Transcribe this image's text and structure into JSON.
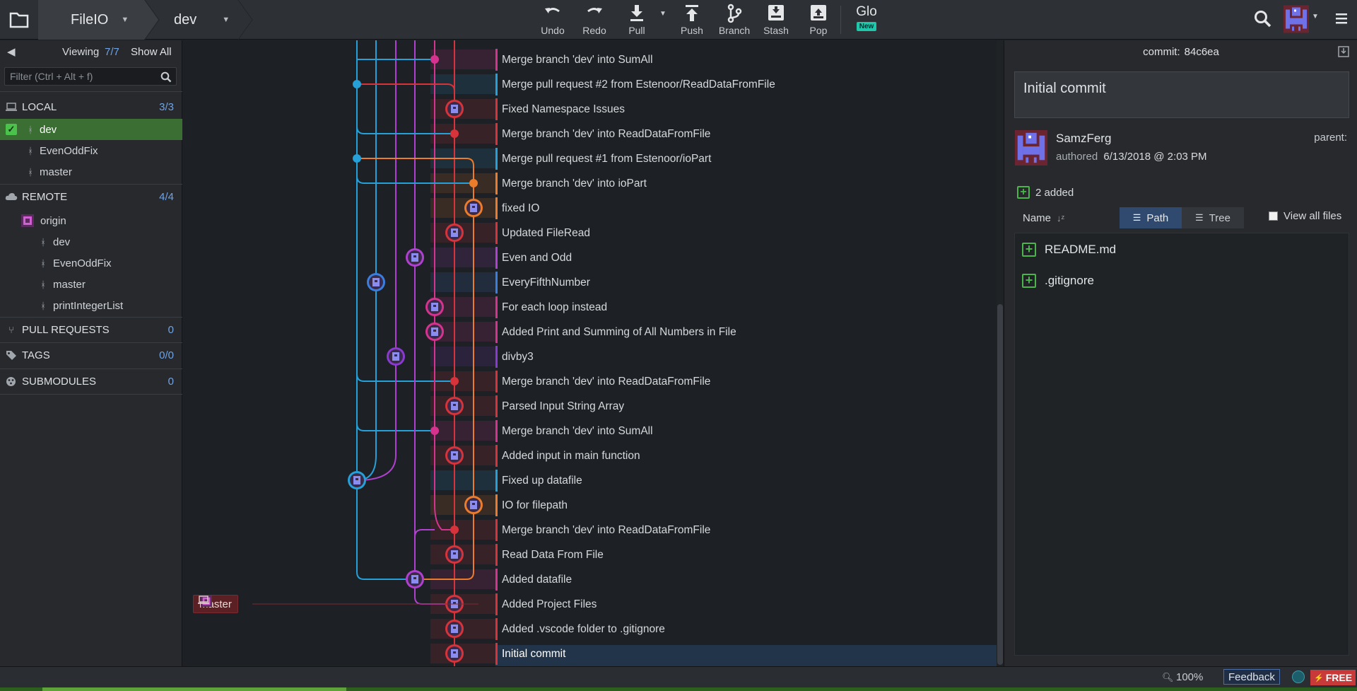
{
  "toolbar": {
    "repo": "FileIO",
    "branch": "dev",
    "buttons": [
      {
        "label": "Undo",
        "icon": "undo-icon"
      },
      {
        "label": "Redo",
        "icon": "redo-icon"
      },
      {
        "label": "Pull",
        "icon": "pull-icon"
      },
      {
        "label": "Push",
        "icon": "push-icon"
      },
      {
        "label": "Branch",
        "icon": "branch-icon"
      },
      {
        "label": "Stash",
        "icon": "stash-icon"
      },
      {
        "label": "Pop",
        "icon": "pop-icon"
      }
    ],
    "glo": "Glo",
    "glo_badge": "New"
  },
  "left": {
    "viewing_label": "Viewing",
    "viewing_count": "7/7",
    "show_all": "Show All",
    "filter_placeholder": "Filter (Ctrl + Alt + f)",
    "local": {
      "label": "LOCAL",
      "count": "3/3",
      "branches": [
        "dev",
        "EvenOddFix",
        "master"
      ]
    },
    "remote": {
      "label": "REMOTE",
      "count": "4/4",
      "origin": "origin",
      "branches": [
        "dev",
        "EvenOddFix",
        "master",
        "printIntegerList"
      ]
    },
    "pull_requests": {
      "label": "PULL REQUESTS",
      "count": "0"
    },
    "tags": {
      "label": "TAGS",
      "count": "0/0"
    },
    "submodules": {
      "label": "SUBMODULES",
      "count": "0"
    }
  },
  "graph": {
    "master_tag": "master",
    "commits": [
      {
        "message": "Merge branch 'dev' into SumAll",
        "stripe": "#d6338f"
      },
      {
        "message": "Merge pull request #2 from Estenoor/ReadDataFromFile",
        "stripe": "#26a0d8"
      },
      {
        "message": "Fixed Namespace Issues",
        "stripe": "#d6333a"
      },
      {
        "message": "Merge branch 'dev' into ReadDataFromFile",
        "stripe": "#d6333a"
      },
      {
        "message": "Merge pull request #1 from Estenoor/ioPart",
        "stripe": "#26a0d8"
      },
      {
        "message": "Merge branch 'dev' into ioPart",
        "stripe": "#ea7c2c"
      },
      {
        "message": "fixed IO",
        "stripe": "#ea7c2c"
      },
      {
        "message": "Updated FileRead",
        "stripe": "#d6333a"
      },
      {
        "message": "Even and Odd",
        "stripe": "#b040d0"
      },
      {
        "message": "EveryFifthNumber",
        "stripe": "#3a7ee0"
      },
      {
        "message": "For each loop instead",
        "stripe": "#d6338f"
      },
      {
        "message": "Added Print and Summing of All Numbers in File",
        "stripe": "#d6338f"
      },
      {
        "message": "divby3",
        "stripe": "#8a3ad0"
      },
      {
        "message": "Merge branch 'dev' into ReadDataFromFile",
        "stripe": "#d6333a"
      },
      {
        "message": "Parsed Input String Array",
        "stripe": "#d6333a"
      },
      {
        "message": "Merge branch 'dev' into SumAll",
        "stripe": "#d6338f"
      },
      {
        "message": "Added input in main function",
        "stripe": "#d6333a"
      },
      {
        "message": "Fixed up datafile",
        "stripe": "#26a0d8"
      },
      {
        "message": "IO for filepath",
        "stripe": "#ea7c2c"
      },
      {
        "message": "Merge branch 'dev' into ReadDataFromFile",
        "stripe": "#d6333a"
      },
      {
        "message": "Read Data From File",
        "stripe": "#d6333a"
      },
      {
        "message": "Added datafile",
        "stripe": "#d6338f"
      },
      {
        "message": "Added Project Files",
        "stripe": "#d6333a"
      },
      {
        "message": "Added .vscode folder to .gitignore",
        "stripe": "#d6333a"
      },
      {
        "message": "Initial commit",
        "stripe": "#d6333a"
      }
    ]
  },
  "right": {
    "commit_label": "commit:",
    "commit_sha": "84c6ea",
    "summary": "Initial commit",
    "author": "SamzFerg",
    "authored_label": "authored",
    "authored_date": "6/13/2018 @ 2:03 PM",
    "parent_label": "parent:",
    "added": "2 added",
    "sort_label": "Name",
    "path_tab": "Path",
    "tree_tab": "Tree",
    "view_all_files": "View all files",
    "files": [
      "README.md",
      ".gitignore"
    ]
  },
  "status": {
    "zoom": "100%",
    "feedback": "Feedback",
    "plan": "FREE"
  },
  "colors": {
    "red": "#d6333a",
    "pink": "#d6338f",
    "cyan": "#26a0d8",
    "orange": "#ea7c2c",
    "blue": "#3a7ee0",
    "purple": "#8a3ad0",
    "violet": "#b040d0"
  }
}
